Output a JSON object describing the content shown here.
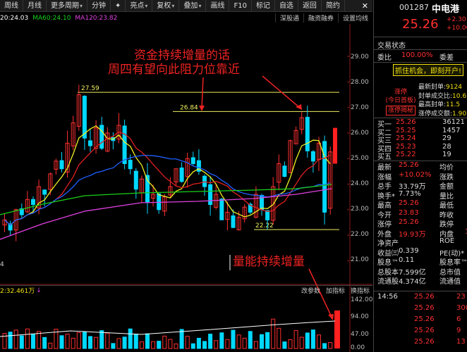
{
  "toolbar": {
    "items": [
      "周线",
      "月线",
      "更多周期",
      "分钟",
      "✦",
      "亮点",
      "复权",
      "叠加",
      "画线",
      "F10",
      "标记",
      "自选",
      "返回",
      "简约"
    ],
    "close": "✕"
  },
  "ma": {
    "ma_a": "20:24.03",
    "ma60": "MA60:24.10",
    "ma120": "MA120:23.82",
    "buttons": [
      "深股通",
      "融资融券",
      "设置均线"
    ]
  },
  "annotations": {
    "line1": "资金持续增量的话",
    "line2": "周四有望向此阻力位靠近",
    "volume": "量能持续增量"
  },
  "levels": {
    "top": "27.59",
    "mid": "26.84",
    "low": "22.22"
  },
  "price_axis": [
    "29.00",
    "28.00",
    "27.00",
    "26.00",
    "25.00",
    "24.00",
    "23.00",
    "22.00",
    "21.00"
  ],
  "vol_axis": [
    "142.00",
    "94.00",
    "47.00",
    "0.00"
  ],
  "volume_bar": {
    "label": "2:32.461万",
    "arrow": "↓",
    "buttons": [
      "改参数",
      "加指标",
      "换指标"
    ]
  },
  "left_edge_digit": "4",
  "quote": {
    "code": "001287",
    "name": "中电港",
    "price": "25.26",
    "chg1": "+2.30",
    "chg2": "+10.00"
  },
  "sections": {
    "trade_status": "交易状态",
    "weibi_label": "委比",
    "weibi_value": "100.00%",
    "weicha_label": "委差"
  },
  "promo": "抓住机会，即刻开户!",
  "limit_up": {
    "label": "涨停",
    "sub": "(今日首板)",
    "tag": "涨停揭秘"
  },
  "seal": {
    "rows": [
      {
        "label": "最新封单:",
        "value": "9124"
      },
      {
        "label": "封单成交比:",
        "value": "10.6"
      },
      {
        "label": "最高封单:",
        "value": "11.5"
      },
      {
        "label": "涨停成交额:",
        "value": "1.90"
      }
    ]
  },
  "order_book": [
    {
      "label": "买一",
      "price": "25.26",
      "vol": "36121"
    },
    {
      "label": "买二",
      "price": "25.25",
      "vol": "1457"
    },
    {
      "label": "买三",
      "price": "25.24",
      "vol": "29"
    },
    {
      "label": "买四",
      "price": "25.23",
      "vol": "28"
    },
    {
      "label": "买五",
      "price": "25.22",
      "vol": "19"
    }
  ],
  "stats": [
    {
      "l1": "最新",
      "v1": "25.26",
      "c1": "red",
      "l2": "均价",
      "v2": ""
    },
    {
      "l1": "涨幅",
      "v1": "+10.02%",
      "c1": "red",
      "l2": "涨跌",
      "v2": ""
    },
    {
      "l1": "总手",
      "v1": "33.79万",
      "c1": "wht",
      "l2": "金额",
      "v2": ""
    },
    {
      "l1": "换手*",
      "v1": "7.73%",
      "c1": "wht",
      "l2": "量比",
      "v2": ""
    },
    {
      "l1": "最高",
      "v1": "25.26",
      "c1": "red",
      "l2": "最低",
      "v2": ""
    },
    {
      "l1": "今开",
      "v1": "23.83",
      "c1": "red",
      "l2": "昨收",
      "v2": ""
    },
    {
      "l1": "涨停",
      "v1": "25.26",
      "c1": "red",
      "l2": "跌停",
      "v2": ""
    },
    {
      "l1": "外盘",
      "v1": "19.93万",
      "c1": "red",
      "l2": "内盘",
      "v2": "1"
    },
    {
      "l1": "净资产",
      "v1": "",
      "c1": "wht",
      "l2": "ROE",
      "v2": ""
    },
    {
      "l1": "收益㈢",
      "v1": "0.339",
      "c1": "wht",
      "l2": "PE(动)*",
      "v2": ""
    },
    {
      "l1": "股息™",
      "v1": "0.11",
      "c1": "wht",
      "l2": "股息率™",
      "v2": ""
    },
    {
      "l1": "总股本",
      "v1": "7.599亿",
      "c1": "wht",
      "l2": "总市值",
      "v2": ""
    },
    {
      "l1": "流通股",
      "v1": "4.374亿",
      "c1": "wht",
      "l2": "流通值",
      "v2": ""
    }
  ],
  "ticks": [
    {
      "time": "14:56",
      "price": "25.26",
      "vol": "23"
    },
    {
      "time": "",
      "price": "25.26",
      "vol": "300"
    },
    {
      "time": "",
      "price": "25.26",
      "vol": "6"
    },
    {
      "time": "",
      "price": "25.26",
      "vol": "9"
    },
    {
      "time": "",
      "price": "25.26",
      "vol": "13"
    }
  ],
  "colors": {
    "bg": "#000000",
    "up": "#ff3030",
    "down": "#00d8ff",
    "annotation": "#ee2222",
    "level_line": "#f0f060"
  }
}
